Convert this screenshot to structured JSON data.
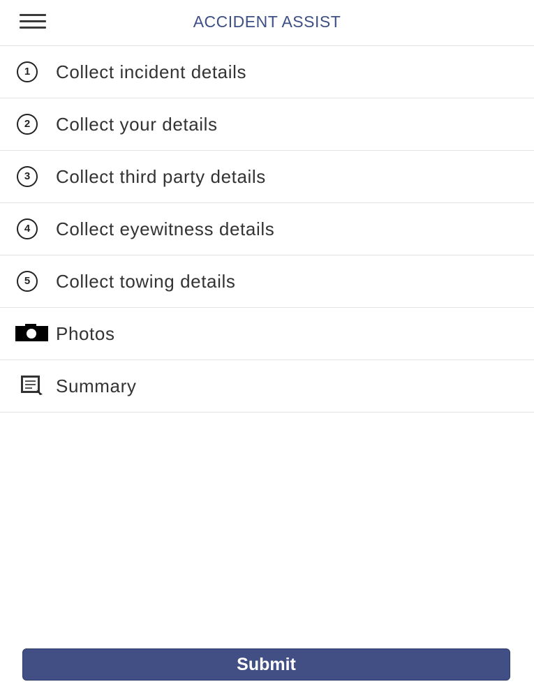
{
  "header": {
    "title": "ACCIDENT ASSIST",
    "menu_icon": "hamburger-menu-icon"
  },
  "steps": [
    {
      "number": "1",
      "label": "Collect incident details"
    },
    {
      "number": "2",
      "label": "Collect your details"
    },
    {
      "number": "3",
      "label": "Collect third party details"
    },
    {
      "number": "4",
      "label": "Collect eyewitness details"
    },
    {
      "number": "5",
      "label": "Collect towing details"
    }
  ],
  "photos": {
    "label": "Photos",
    "icon": "camera-icon"
  },
  "summary": {
    "label": "Summary",
    "icon": "summary-icon"
  },
  "submit": {
    "label": "Submit"
  },
  "colors": {
    "accent": "#414f85",
    "title": "#3d4f86",
    "divider": "#e2e2e2"
  }
}
